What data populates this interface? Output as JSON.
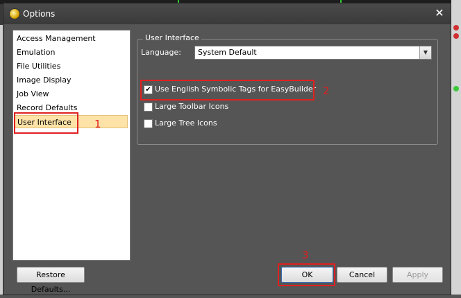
{
  "dialog": {
    "title": "Options",
    "close_glyph": "✕"
  },
  "categories": [
    {
      "label": "Access Management"
    },
    {
      "label": "Emulation"
    },
    {
      "label": "File Utilities"
    },
    {
      "label": "Image Display"
    },
    {
      "label": "Job View"
    },
    {
      "label": "Record Defaults"
    },
    {
      "label": "User Interface",
      "selected": true
    }
  ],
  "group": {
    "title": "User Interface",
    "language_label": "Language:",
    "language_value": "System Default",
    "options": [
      {
        "label": "Use English Symbolic Tags for EasyBuilder",
        "checked": true
      },
      {
        "label": "Large Toolbar Icons",
        "checked": false
      },
      {
        "label": "Large Tree Icons",
        "checked": false
      }
    ]
  },
  "buttons": {
    "restore": "Restore Defaults...",
    "ok": "OK",
    "cancel": "Cancel",
    "apply": "Apply"
  },
  "annotations": {
    "marker1": "1",
    "marker2": "2",
    "marker3": "3",
    "color": "#e02020"
  },
  "icons": {
    "title_icon": "options-gear-icon",
    "check": "✔",
    "dropdown": "▼"
  }
}
